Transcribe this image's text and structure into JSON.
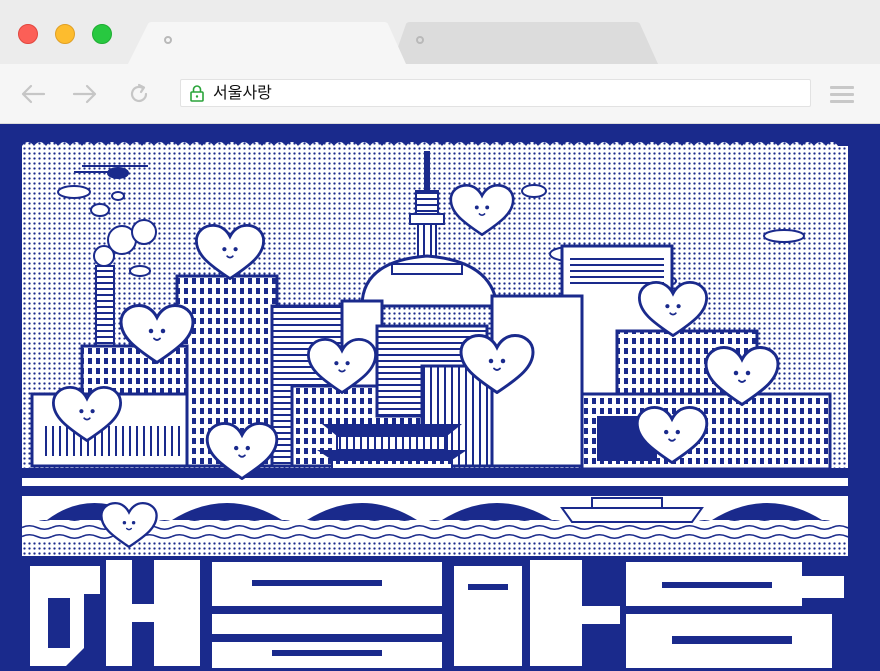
{
  "browser": {
    "address": "서울사랑",
    "tabs": [
      {
        "label": ""
      },
      {
        "label": ""
      }
    ]
  },
  "colors": {
    "poster_blue": "#1a2a8c",
    "close": "#fc5f57",
    "minimize": "#fdbc2e",
    "maximize": "#28c840",
    "lock": "#2aa43a"
  },
  "icons": {
    "back": "arrow-left-icon",
    "forward": "arrow-right-icon",
    "reload": "reload-icon",
    "lock": "lock-icon",
    "menu": "hamburger-menu-icon"
  }
}
